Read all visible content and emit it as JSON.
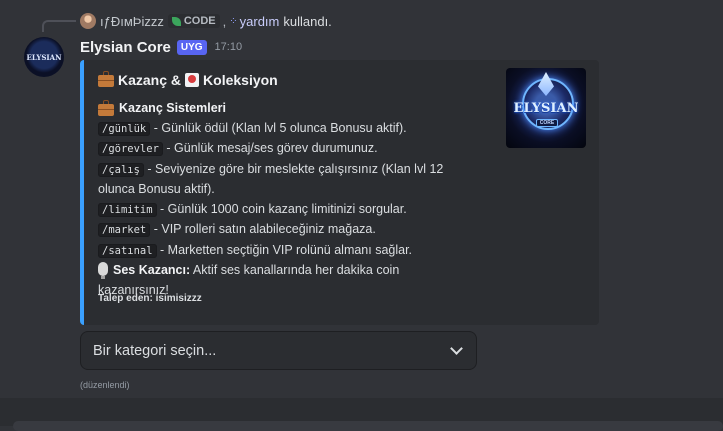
{
  "reply": {
    "username": "ıƒÐıмÞizzz",
    "app_label": "CODE",
    "separator": ",",
    "command_name": "yardım",
    "suffix": "kullandı."
  },
  "message": {
    "author": "Elysian Core",
    "badge": "UYG",
    "time": "17:10",
    "avatar_text": "ELYSIAN"
  },
  "embed": {
    "accent_color": "#3aa0ff",
    "title_part1": "Kazanç &",
    "title_part2": "Koleksiyon",
    "section_title": "Kazanç Sistemleri",
    "commands": [
      {
        "cmd": "/günlük",
        "desc": " - Günlük ödül (Klan lvl 5 olunca Bonusu aktif)."
      },
      {
        "cmd": "/görevler",
        "desc": " - Günlük mesaj/ses görev durumunuz."
      },
      {
        "cmd": "/çalış",
        "desc": " - Seviyenize göre bir meslekte çalışırsınız (Klan lvl 12"
      },
      {
        "cmd": "",
        "desc": "olunca Bonusu aktif)."
      },
      {
        "cmd": "/limitim",
        "desc": " - Günlük 1000 coin kazanç limitinizi sorgular."
      },
      {
        "cmd": "/market",
        "desc": " - VIP rolleri satın alabileceğiniz mağaza."
      },
      {
        "cmd": "/satınal",
        "desc": " - Marketten seçtiğin VIP rolünü almanı sağlar."
      }
    ],
    "voice_label": "Ses Kazancı:",
    "voice_text": " Aktif ses kanallarında her dakika coin",
    "voice_text_cont": "kazanırsınız!",
    "footer": "Talep eden: isimisizzz",
    "thumbnail_title": "ELYSIAN",
    "thumbnail_sub": "CORE"
  },
  "select": {
    "placeholder": "Bir kategori seçin..."
  },
  "edited_label": "(düzenlendi)"
}
